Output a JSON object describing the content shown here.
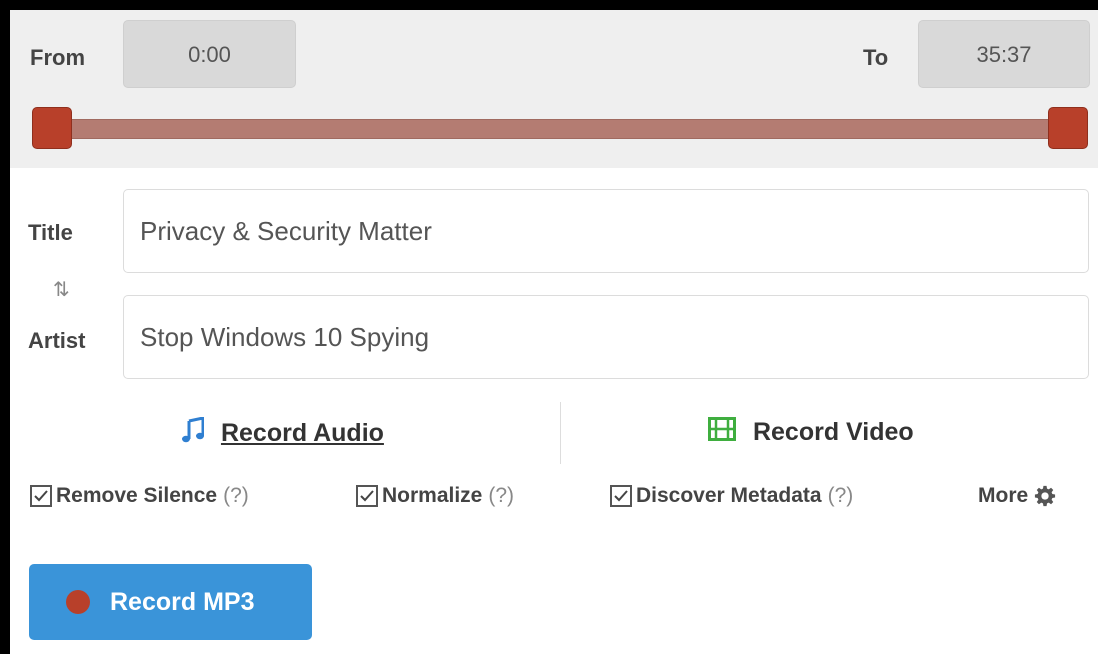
{
  "range": {
    "from_label": "From",
    "from_value": "0:00",
    "to_label": "To",
    "to_value": "35:37",
    "start_fraction": 0.0,
    "end_fraction": 1.0
  },
  "fields": {
    "title_label": "Title",
    "title_value": "Privacy & Security Matter",
    "artist_label": "Artist",
    "artist_value": "Stop Windows 10 Spying",
    "swap_icon": "swap-vertical-icon"
  },
  "modes": {
    "audio_label": "Record Audio",
    "audio_icon": "music-note-icon",
    "audio_active": true,
    "video_label": "Record Video",
    "video_icon": "film-icon"
  },
  "options": [
    {
      "label": "Remove Silence",
      "help": "(?)",
      "checked": true
    },
    {
      "label": "Normalize",
      "help": "(?)",
      "checked": true
    },
    {
      "label": "Discover Metadata",
      "help": "(?)",
      "checked": true
    }
  ],
  "more": {
    "label": "More",
    "icon": "gear-icon"
  },
  "record_button": {
    "label": "Record MP3"
  },
  "colors": {
    "accent_blue": "#3a94d9",
    "handle_red": "#b8402a",
    "track": "#b47c72",
    "audio_icon": "#2f7fd1",
    "video_icon": "#3fae3f"
  }
}
